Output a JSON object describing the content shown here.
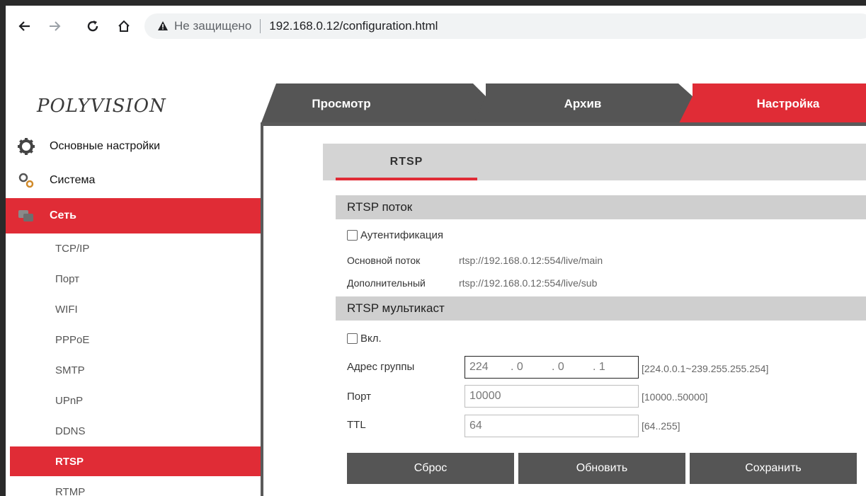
{
  "browser": {
    "security_text": "Не защищено",
    "url": "192.168.0.12/configuration.html"
  },
  "logo": {
    "text": "POLYVISION"
  },
  "top_tabs": [
    {
      "label": "Просмотр",
      "active": false
    },
    {
      "label": "Архив",
      "active": false
    },
    {
      "label": "Настройка",
      "active": true
    }
  ],
  "sidebar": {
    "main_items": [
      {
        "label": "Основные настройки",
        "icon": "gear-icon",
        "active": false
      },
      {
        "label": "Система",
        "icon": "gears-icon",
        "active": false
      },
      {
        "label": "Сеть",
        "icon": "network-icon",
        "active": true
      }
    ],
    "sub_items": [
      {
        "label": "TCP/IP",
        "active": false
      },
      {
        "label": "Порт",
        "active": false
      },
      {
        "label": "WIFI",
        "active": false
      },
      {
        "label": "PPPoE",
        "active": false
      },
      {
        "label": "SMTP",
        "active": false
      },
      {
        "label": "UPnP",
        "active": false
      },
      {
        "label": "DDNS",
        "active": false
      },
      {
        "label": "RTSP",
        "active": true
      },
      {
        "label": "RTMP",
        "active": false
      }
    ]
  },
  "subtab": {
    "label": "RTSP"
  },
  "rtsp_stream": {
    "heading": "RTSP поток",
    "auth_label": "Аутентификация",
    "main_label": "Основной поток",
    "main_url": "rtsp://192.168.0.12:554/live/main",
    "sub_label": "Дополнительный",
    "sub_url": "rtsp://192.168.0.12:554/live/sub"
  },
  "rtsp_multicast": {
    "heading": "RTSP мультикаст",
    "enable_label": "Вкл.",
    "group_label": "Адрес группы",
    "group_ip": [
      "224",
      ". 0",
      ". 0",
      ". 1"
    ],
    "group_range": "[224.0.0.1~239.255.255.254]",
    "port_label": "Порт",
    "port_value": "10000",
    "port_range": "[10000..50000]",
    "ttl_label": "TTL",
    "ttl_value": "64",
    "ttl_range": "[64..255]"
  },
  "buttons": {
    "reset": "Сброс",
    "refresh": "Обновить",
    "save": "Сохранить"
  },
  "colors": {
    "accent": "#e02c36",
    "tab_dark": "#555555",
    "section_bg": "#cfcfcf"
  }
}
